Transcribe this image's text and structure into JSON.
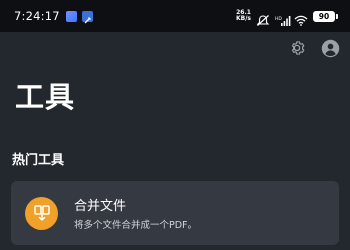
{
  "status_bar": {
    "time": "7:24:17",
    "net_speed_value": "26.1",
    "net_speed_unit": "KB/s",
    "battery": "90",
    "icons": [
      "app-notification-icon",
      "tool-notification-icon",
      "mute-icon",
      "hd-signal-icon",
      "wifi-icon",
      "battery-icon"
    ]
  },
  "header": {
    "actions": [
      "settings-icon",
      "account-icon"
    ]
  },
  "page": {
    "title": "工具",
    "section_title": "热门工具"
  },
  "tools": [
    {
      "name": "合并文件",
      "description": "将多个文件合并成一个PDF。",
      "icon": "merge-files-icon",
      "icon_color": "#f1a12a"
    }
  ],
  "colors": {
    "background": "#23272e",
    "card": "#353a42",
    "status_bar": "#0d0f12",
    "accent": "#f1a12a"
  }
}
